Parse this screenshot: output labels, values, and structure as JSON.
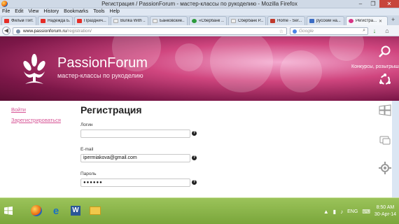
{
  "window": {
    "title": "Регистрация / PassionForum - мастер-классы по рукоделию - Mozilla Firefox",
    "minimize": "–",
    "maximize": "❐",
    "close": "✕"
  },
  "menu": [
    "File",
    "Edit",
    "View",
    "History",
    "Bookmarks",
    "Tools",
    "Help"
  ],
  "tabs": [
    {
      "label": "Фильм Пит...",
      "favicon_color": "#e52d27"
    },
    {
      "label": "Надежда Б...",
      "favicon_color": "#e52d27"
    },
    {
      "label": "Празднич...",
      "favicon_color": "#e52d27"
    },
    {
      "label": "Bunka With ...",
      "favicon_color": "#e8e8e8"
    },
    {
      "label": "Банковские...",
      "favicon_color": "#e8e8e8"
    },
    {
      "label": "«Сбербанк ...",
      "favicon_color": "#2c9a3b"
    },
    {
      "label": "Сбербанк Р...",
      "favicon_color": "#e8e8e8"
    },
    {
      "label": "Home - Ser...",
      "favicon_color": "#c0392b"
    },
    {
      "label": "русский на...",
      "favicon_color": "#3b6cc4"
    },
    {
      "label": "Регистра...",
      "favicon_color": "#d63384",
      "active": true
    }
  ],
  "tab_add": "+",
  "nav": {
    "url_host": "www.passionforum.ru",
    "url_path": "/registration/",
    "search_placeholder": "Google"
  },
  "header": {
    "brand_name": "PassionForum",
    "brand_tagline": "мастер-классы по рукоделию",
    "contests_link": "Конкурсы, розыгрыши"
  },
  "sidebar": {
    "login_link": "Войти",
    "register_link": "Зарегистрироваться"
  },
  "form": {
    "title": "Регистрация",
    "login_label": "Логин",
    "login_value": "",
    "email_label": "E-mail",
    "email_value": "ipermiakova@gmail.com",
    "password_label": "Пароль",
    "password_value": "●●●●●●",
    "help_glyph": "?"
  },
  "taskbar": {
    "language": "ENG",
    "time": "8:50 AM",
    "date": "30-Apr-14"
  },
  "colors": {
    "accent_pink": "#d65294",
    "taskbar_green": "#8ab84a",
    "header_magenta": "#a0245f"
  }
}
